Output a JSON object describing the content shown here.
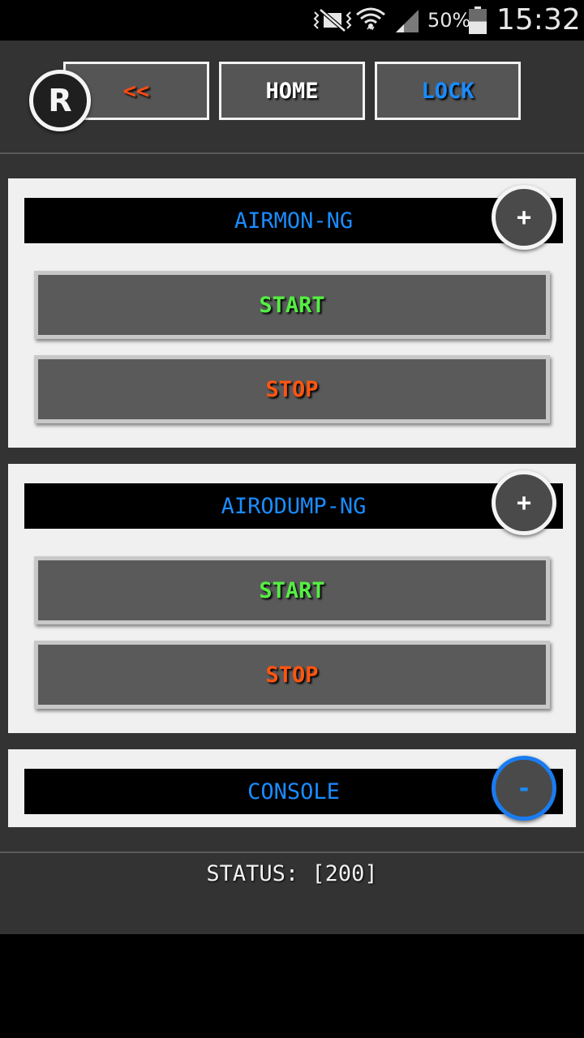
{
  "status_bar": {
    "battery_percent": "50%",
    "battery_level": 0.5,
    "time": "15:32",
    "icons": [
      "vibrate-mute-icon",
      "wifi-icon",
      "signal-icon",
      "battery-icon"
    ]
  },
  "header": {
    "logo_letter": "R",
    "back_label": "<<",
    "home_label": "HOME",
    "lock_label": "LOCK"
  },
  "sections": [
    {
      "title": "AIRMON-NG",
      "toggle": "+",
      "start_label": "START",
      "stop_label": "STOP"
    },
    {
      "title": "AIRODUMP-NG",
      "toggle": "+",
      "start_label": "START",
      "stop_label": "STOP"
    },
    {
      "title": "CONSOLE",
      "toggle": "-"
    }
  ],
  "status_text": "STATUS: [200]",
  "colors": {
    "accent_blue": "#1a8cff",
    "start_green": "#55ee44",
    "stop_orange": "#ff5511",
    "back_orange": "#ff4a12",
    "app_background": "#333333",
    "card_background": "#f0f0f0"
  }
}
